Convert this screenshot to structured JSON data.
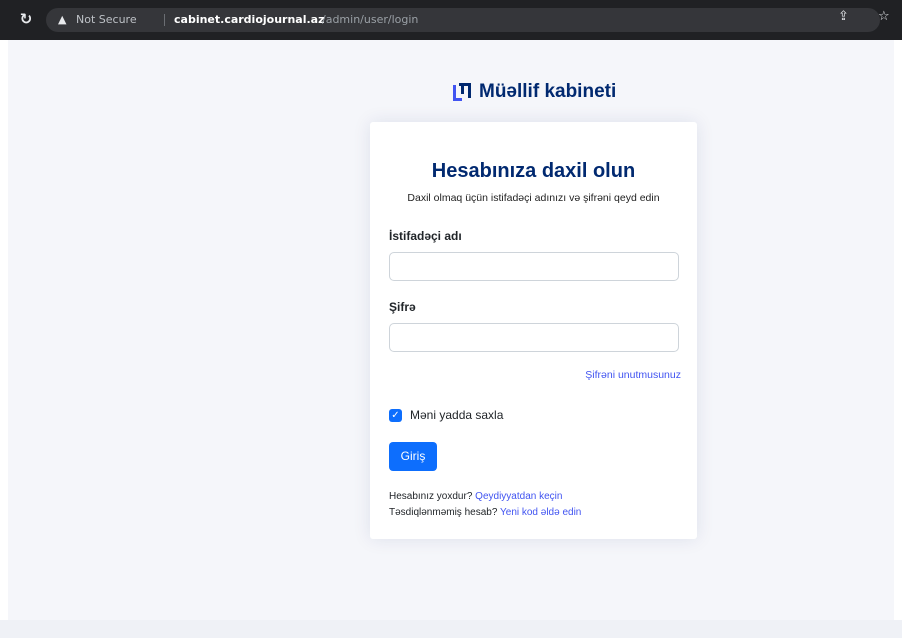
{
  "browser": {
    "security_label": "Not Secure",
    "url_host": "cabinet.cardiojournal.az",
    "url_path": "/admin/user/login",
    "icons": [
      "reload-icon",
      "warning-icon",
      "share-icon",
      "bookmark-star-icon"
    ]
  },
  "brand": {
    "name": "Müəllif kabineti",
    "logo_icon": "brand-logo-icon"
  },
  "login": {
    "title": "Hesabınıza daxil olun",
    "subtitle": "Daxil olmaq üçün istifadəçi adınızı və şifrəni qeyd edin",
    "username_label": "İstifadəçi adı",
    "username_value": "",
    "password_label": "Şifrə",
    "password_value": "",
    "forgot_link": "Şifrəni unutmusunuz",
    "remember_label": "Məni yadda saxla",
    "remember_checked": true,
    "submit_label": "Giriş",
    "register_prompt": "Hesabınız yoxdur?",
    "register_link": "Qeydiyyatdan keçin",
    "unverified_prompt": "Təsdiqlənməmiş hesab?",
    "new_code_link": "Yeni kod əldə edin"
  },
  "colors": {
    "brand": "#012970",
    "link": "#4154f1",
    "primary_button": "#0d6efd",
    "page_background": "#f5f6fa"
  }
}
